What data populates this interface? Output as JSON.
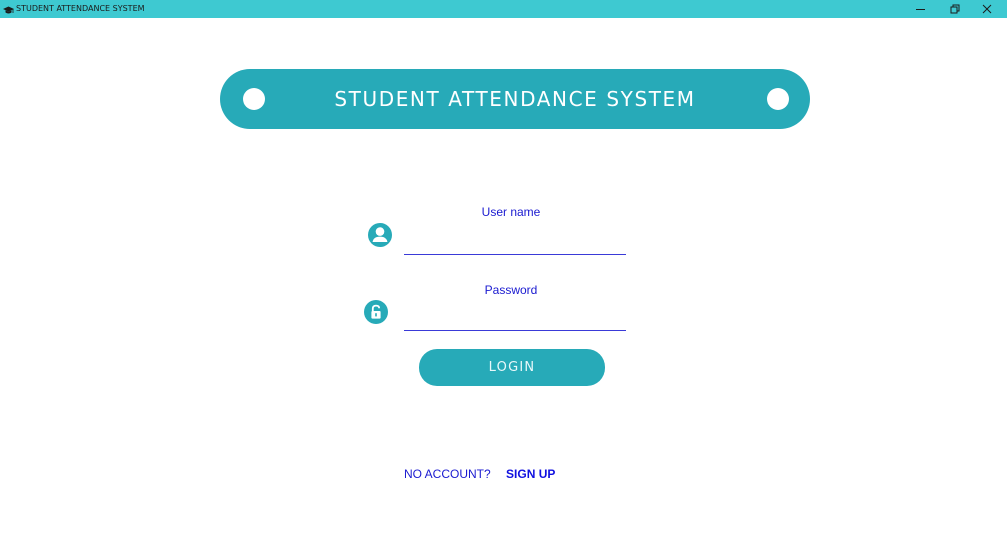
{
  "window": {
    "title": "STUDENT ATTENDANCE SYSTEM",
    "icons": {
      "app": "graduation-cap-icon",
      "minimize": "minimize-icon",
      "maximize": "restore-icon",
      "close": "close-icon"
    }
  },
  "banner": {
    "title": "STUDENT ATTENDANCE SYSTEM"
  },
  "form": {
    "username": {
      "label": "User name",
      "value": "",
      "icon": "user-icon"
    },
    "password": {
      "label": "Password",
      "value": "",
      "icon": "lock-icon"
    },
    "login_label": "LOGIN"
  },
  "footer": {
    "prompt": "NO ACCOUNT?",
    "signup_label": "SIGN UP"
  },
  "colors": {
    "titlebar": "#3ec9d1",
    "accent": "#27aab8",
    "label_text": "#1a1ad0",
    "background": "#ffffff"
  }
}
